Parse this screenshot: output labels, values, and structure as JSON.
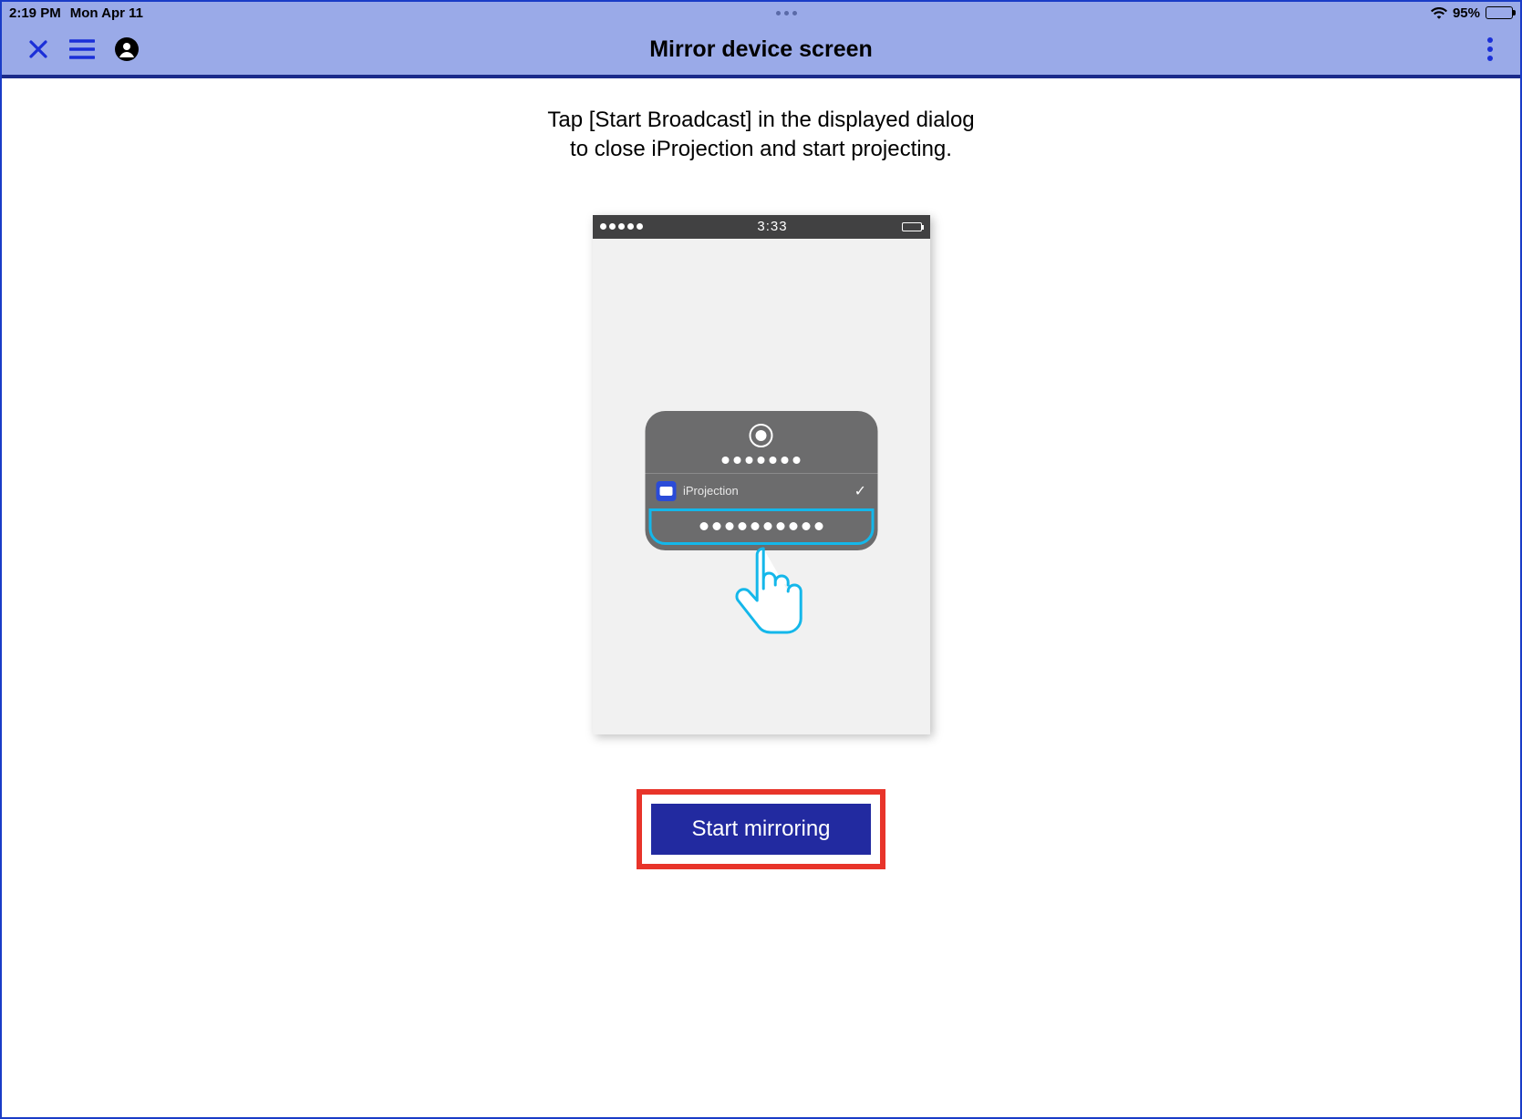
{
  "status_bar": {
    "time": "2:19 PM",
    "date": "Mon Apr 11",
    "battery_percent": "95%"
  },
  "header": {
    "title": "Mirror device screen"
  },
  "instructions": {
    "line1": "Tap [Start Broadcast] in the displayed dialog",
    "line2": "to close iProjection and start projecting."
  },
  "illustration": {
    "phone_time": "3:33",
    "app_name": "iProjection"
  },
  "primary_button_label": "Start mirroring",
  "colors": {
    "header_bg": "#9aaae8",
    "accent_blue": "#1a2fd8",
    "button_bg": "#222aa0",
    "highlight_cyan": "#14b7ea",
    "callout_red": "#e8342a"
  }
}
